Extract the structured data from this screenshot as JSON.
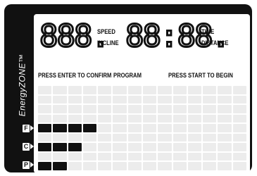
{
  "brand": {
    "label": "EnergyZONE™"
  },
  "display": {
    "left_digits": "888.",
    "right_digits": "88:88.",
    "left_labels": [
      "SPEED",
      "INCLINE"
    ],
    "right_labels": [
      "TIME",
      "DISTANCE"
    ]
  },
  "prompts": {
    "confirm": "PRESS ENTER TO CONFIRM",
    "program": "PROGRAM",
    "start": "PRESS START TO BEGIN"
  },
  "profile_rows": [
    {
      "marker": "F",
      "lit_cells": 4
    },
    {
      "marker": "C",
      "lit_cells": 3
    },
    {
      "marker": "P",
      "lit_cells": 2
    }
  ],
  "colors": {
    "frame": "#111111",
    "screen": "#ffffff",
    "segment_off": "#ececec",
    "segment_on": "#111111"
  }
}
